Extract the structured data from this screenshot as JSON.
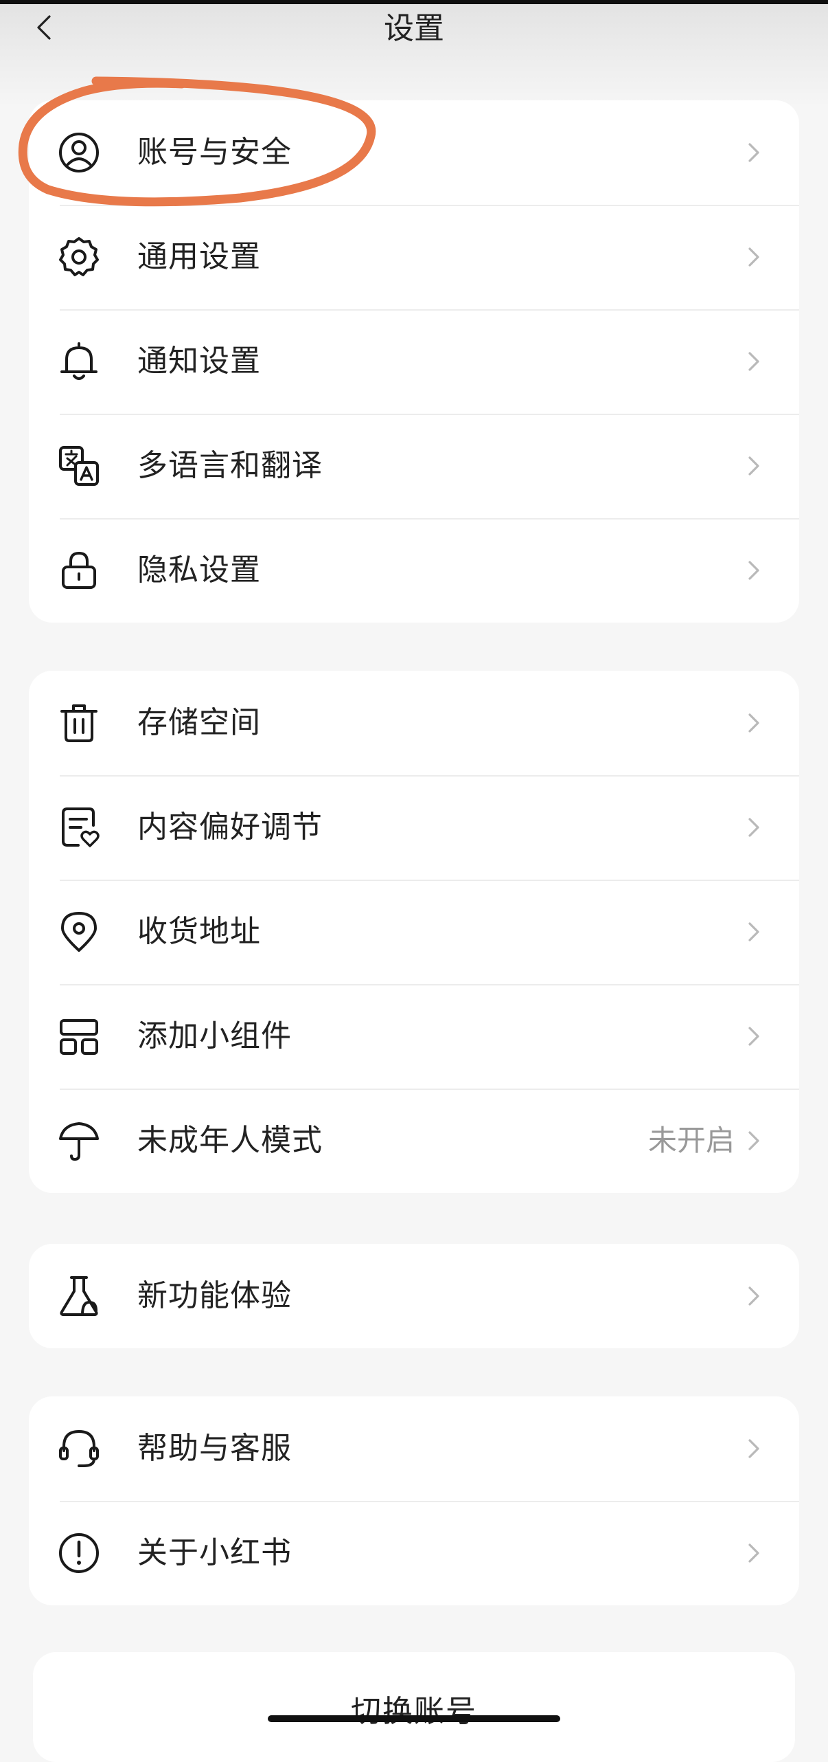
{
  "header": {
    "title": "设置",
    "back_icon": "chevron-left-icon"
  },
  "groups": [
    {
      "items": [
        {
          "label": "账号与安全",
          "icon": "account-circle-icon"
        },
        {
          "label": "通用设置",
          "icon": "gear-icon"
        },
        {
          "label": "通知设置",
          "icon": "bell-icon"
        },
        {
          "label": "多语言和翻译",
          "icon": "translate-icon"
        },
        {
          "label": "隐私设置",
          "icon": "lock-icon"
        }
      ]
    },
    {
      "items": [
        {
          "label": "存储空间",
          "icon": "trash-icon"
        },
        {
          "label": "内容偏好调节",
          "icon": "document-heart-icon"
        },
        {
          "label": "收货地址",
          "icon": "location-pin-icon"
        },
        {
          "label": "添加小组件",
          "icon": "widgets-icon"
        },
        {
          "label": "未成年人模式",
          "icon": "umbrella-icon",
          "value": "未开启"
        }
      ]
    },
    {
      "items": [
        {
          "label": "新功能体验",
          "icon": "flask-icon"
        }
      ]
    },
    {
      "items": [
        {
          "label": "帮助与客服",
          "icon": "headset-icon"
        },
        {
          "label": "关于小红书",
          "icon": "info-circle-icon"
        }
      ]
    }
  ],
  "footer": {
    "switch_account_label": "切换账号"
  },
  "colors": {
    "background": "#f6f6f6",
    "card": "#ffffff",
    "annotation": "#e8794a",
    "secondary_text": "#999999"
  }
}
